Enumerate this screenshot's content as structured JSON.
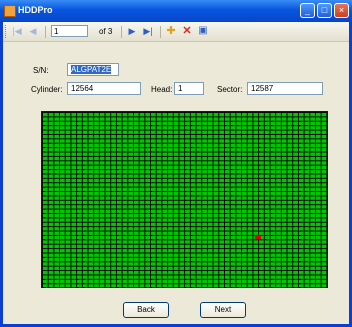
{
  "window": {
    "title": "HDDPro"
  },
  "toolbar": {
    "position_value": "1",
    "of_count": "of 3",
    "first_icon": "first-record-icon",
    "prev_icon": "prev-record-icon",
    "next_icon": "next-record-icon",
    "last_icon": "last-record-icon",
    "add_icon": "add-icon",
    "delete_icon": "delete-icon",
    "save_icon": "save-icon"
  },
  "form": {
    "sn_label": "S/N:",
    "sn_value": "ALGPAT2E",
    "cylinder_label": "Cylinder:",
    "cylinder_value": "12564",
    "head_label": "Head:",
    "head_value": "1",
    "sector_label": "Sector:",
    "sector_value": "12587"
  },
  "grid": {
    "cell_color": "#00c800",
    "line_color": "#0a0a0a",
    "marker_color": "#e00000"
  },
  "buttons": {
    "back": "Back",
    "next": "Next"
  }
}
